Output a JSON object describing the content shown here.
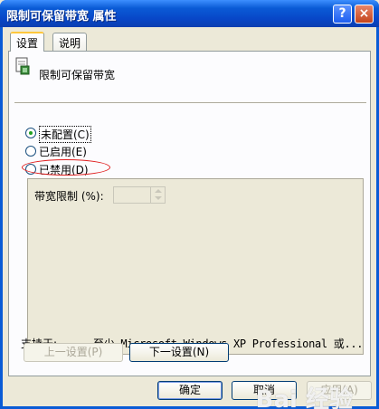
{
  "window": {
    "title": "限制可保留带宽 属性",
    "help_label": "?",
    "close_label": "×"
  },
  "tabs": [
    {
      "label": "设置",
      "active": true
    },
    {
      "label": "说明",
      "active": false
    }
  ],
  "policy": {
    "title": "限制可保留带宽",
    "icon": "policy-setting-icon"
  },
  "radios": [
    {
      "label": "未配置(C)",
      "selected": true
    },
    {
      "label": "已启用(E)",
      "selected": false
    },
    {
      "label": "已禁用(D)",
      "selected": false
    }
  ],
  "options": {
    "bandwidth_label": "带宽限制 (%):",
    "bandwidth_value": ""
  },
  "supported": {
    "label": "支持于:",
    "value": "至少 Microsoft Windows XP Professional 或..."
  },
  "buttons": {
    "prev": "上一设置(P)",
    "next": "下一设置(N)",
    "ok": "确定",
    "cancel": "取消",
    "apply": "应用(A)"
  },
  "watermark": "Bai 经验",
  "colors": {
    "titlebar": "#0a5bd6",
    "dialog_bg": "#ece9d8",
    "annotation": "#e02020",
    "radio_selected": "#21a121"
  }
}
